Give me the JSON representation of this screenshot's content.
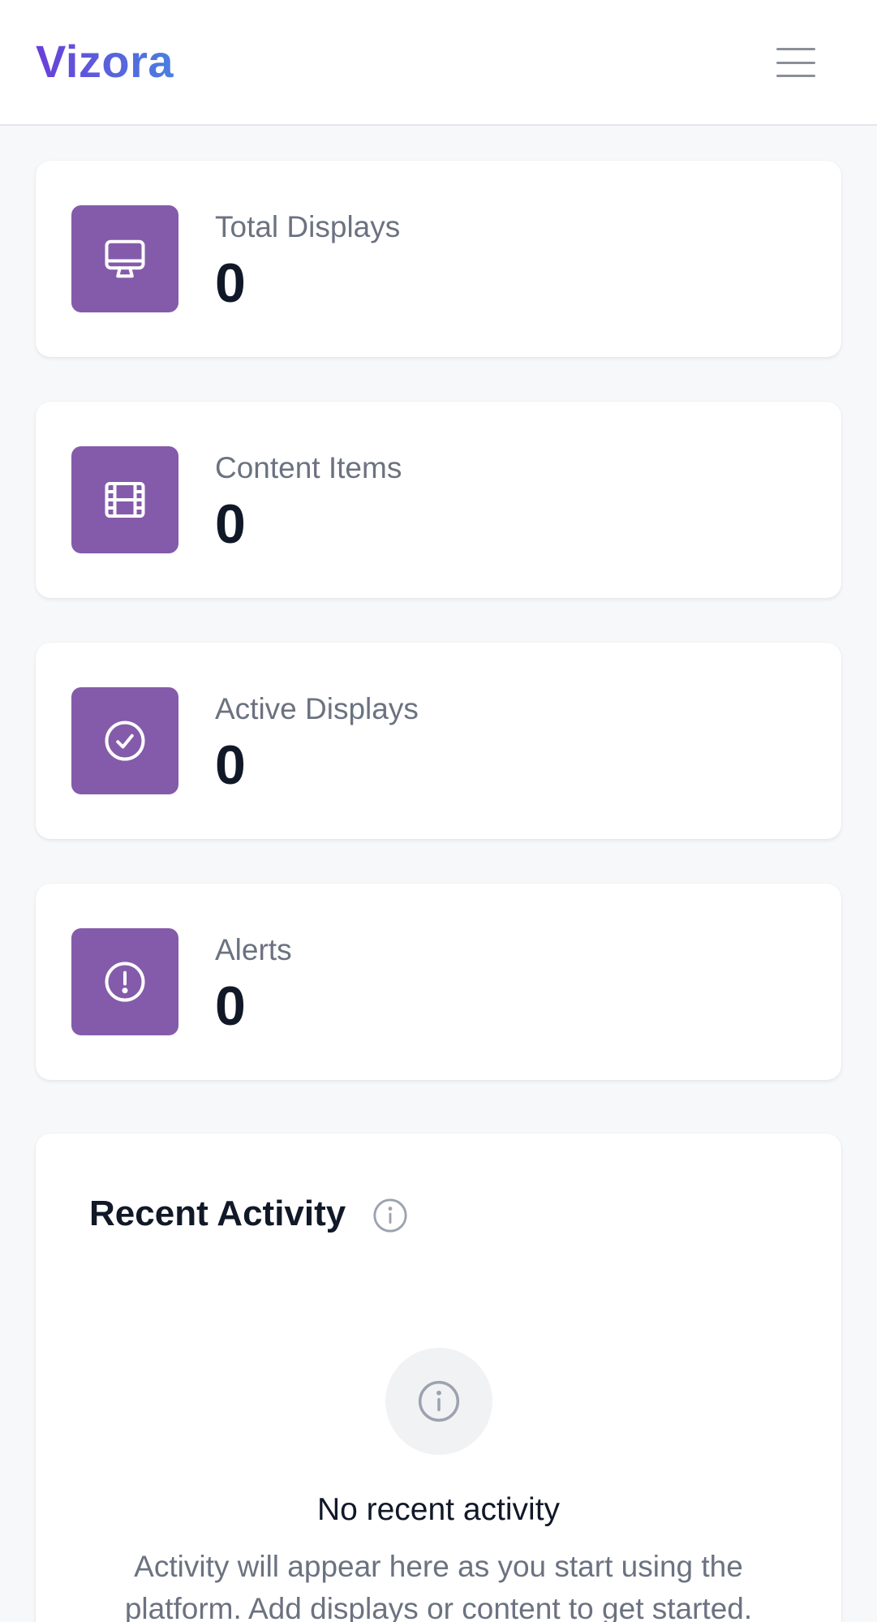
{
  "header": {
    "brand": "Vizora",
    "menu_icon": "hamburger-menu-icon"
  },
  "stats": [
    {
      "label": "Total Displays",
      "value": "0",
      "icon": "monitor-icon"
    },
    {
      "label": "Content Items",
      "value": "0",
      "icon": "film-icon"
    },
    {
      "label": "Active Displays",
      "value": "0",
      "icon": "check-circle-icon"
    },
    {
      "label": "Alerts",
      "value": "0",
      "icon": "alert-circle-icon"
    }
  ],
  "activity": {
    "title": "Recent Activity",
    "info_icon": "info-icon",
    "empty_icon": "info-icon",
    "empty_title": "No recent activity",
    "empty_description": "Activity will appear here as you start using the platform. Add displays or content to get started."
  },
  "colors": {
    "accent": "#845baa",
    "brand_gradient_start": "#6a3fd8",
    "brand_gradient_end": "#4a7fe0",
    "muted_text": "#6b7280",
    "strong_text": "#111827",
    "background": "#f7f8fa"
  }
}
